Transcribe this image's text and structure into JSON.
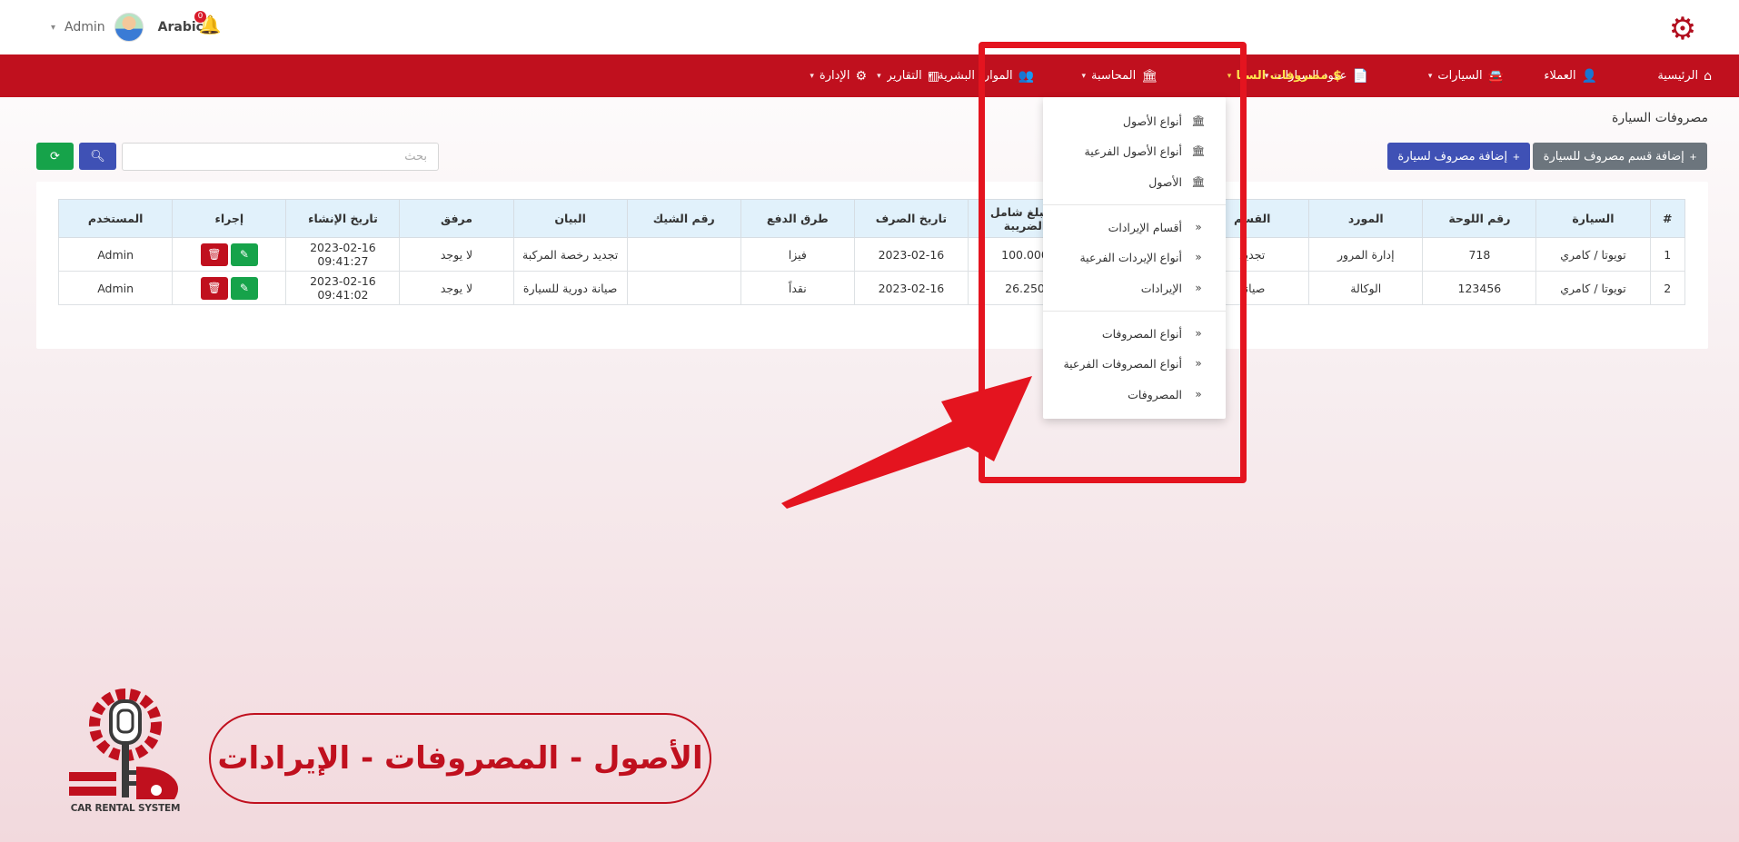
{
  "colors": {
    "primary": "#c0101e",
    "active_nav": "#ffe14d",
    "table_header": "#e1f1fb",
    "annotation": "#e4141f"
  },
  "header": {
    "user_name": "Admin",
    "language": "Arabic",
    "notifications_count": "0"
  },
  "nav": {
    "items": [
      {
        "label": "الرئيسية",
        "icon": "home-icon"
      },
      {
        "label": "العملاء",
        "icon": "user-icon"
      },
      {
        "label": "السيارات",
        "icon": "car-icon"
      },
      {
        "label": "عقود السيارات",
        "icon": "file-icon"
      },
      {
        "label": "مصروفات السيارة",
        "icon": "dollar-icon"
      },
      {
        "label": "المحاسبة",
        "icon": "bank-icon"
      },
      {
        "label": "الموارد البشرية",
        "icon": "users-icon"
      },
      {
        "label": "التقارير",
        "icon": "chart-icon"
      },
      {
        "label": "الإدارة",
        "icon": "gear-icon"
      }
    ]
  },
  "page": {
    "title": "مصروفات السيارة",
    "add_category_button": "إضافة قسم مصروف للسيارة",
    "add_expense_button": "إضافة مصروف لسيارة",
    "search_placeholder": "بحث"
  },
  "table": {
    "headers": [
      "#",
      "السيارة",
      "رقم اللوحة",
      "المورد",
      "القسم",
      "",
      "المبلغ شامل الضريبة",
      "تاريخ الصرف",
      "طرق الدفع",
      "رقم الشيك",
      "البيان",
      "مرفق",
      "تاريخ الإنشاء",
      "إجراء",
      "المستخدم"
    ],
    "rows": [
      [
        "1",
        "تويوتا / كامري",
        "718",
        "إدارة المرور",
        "تجديد",
        "",
        "100.000",
        "2023-02-16",
        "فيزا",
        "",
        "تجديد رخصة المركبة",
        "لا يوجد",
        "2023-02-16 09:41:27",
        "",
        "Admin"
      ],
      [
        "2",
        "تويوتا / كامري",
        "123456",
        "الوكالة",
        "صيانة",
        "",
        "26.250",
        "2023-02-16",
        "نقداً",
        "",
        "صيانة دورية للسيارة",
        "لا يوجد",
        "2023-02-16 09:41:02",
        "",
        "Admin"
      ]
    ]
  },
  "dropdown": {
    "items": [
      {
        "label": "أنواع الأصول",
        "icon": "bank-icon"
      },
      {
        "label": "أنواع الأصول الفرعية",
        "icon": "bank-icon"
      },
      {
        "label": "الأصول",
        "icon": "bank-icon"
      },
      {
        "label": "أقسام الإيرادات",
        "icon": "double-chevron-icon"
      },
      {
        "label": "أنواع الإيردات الفرعية",
        "icon": "double-chevron-icon"
      },
      {
        "label": "الإيرادات",
        "icon": "double-chevron-icon"
      },
      {
        "label": "أنواع المصروفات",
        "icon": "double-chevron-icon"
      },
      {
        "label": "أنواع المصروفات الفرعية",
        "icon": "double-chevron-icon"
      },
      {
        "label": "المصروفات",
        "icon": "double-chevron-icon"
      }
    ]
  },
  "banner": {
    "text": "الأصول - المصروفات - الإيرادات",
    "logo_caption": "CAR RENTAL SYSTEM"
  }
}
